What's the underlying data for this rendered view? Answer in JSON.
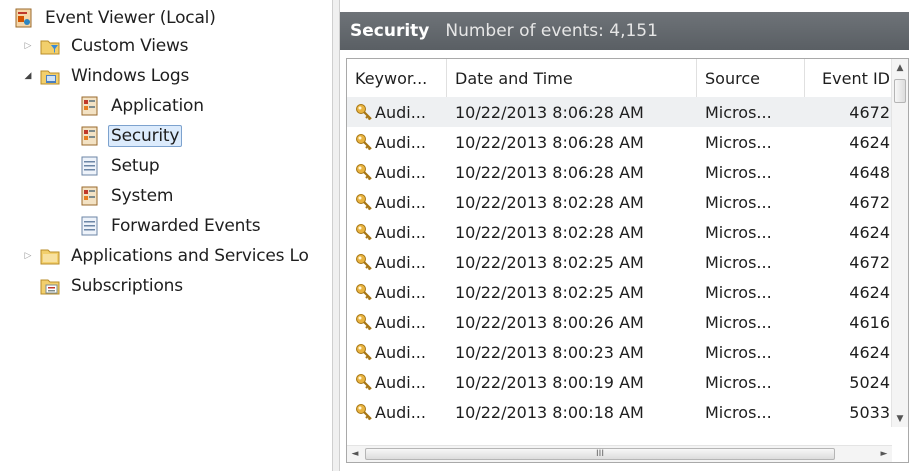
{
  "tree": {
    "root": {
      "label": "Event Viewer (Local)",
      "icon": "event-viewer-icon"
    },
    "items": [
      {
        "label": "Custom Views",
        "icon": "folder-filter-icon",
        "expander": "collapsed"
      },
      {
        "label": "Windows Logs",
        "icon": "windows-logs-icon",
        "expander": "expanded"
      },
      {
        "label": "Application",
        "icon": "log-icon"
      },
      {
        "label": "Security",
        "icon": "log-icon",
        "selected": true
      },
      {
        "label": "Setup",
        "icon": "log-plain-icon"
      },
      {
        "label": "System",
        "icon": "log-icon"
      },
      {
        "label": "Forwarded Events",
        "icon": "log-plain-icon"
      },
      {
        "label": "Applications and Services Lo",
        "icon": "folder-icon",
        "expander": "collapsed"
      },
      {
        "label": "Subscriptions",
        "icon": "subscriptions-icon"
      }
    ]
  },
  "panel": {
    "title": "Security",
    "count_text": "Number of events: 4,151"
  },
  "grid": {
    "columns": [
      "Keywor...",
      "Date and Time",
      "Source",
      "Event ID"
    ],
    "rows": [
      {
        "keyword": "Audi...",
        "datetime": "10/22/2013 8:06:28 AM",
        "source": "Micros...",
        "event_id": "4672"
      },
      {
        "keyword": "Audi...",
        "datetime": "10/22/2013 8:06:28 AM",
        "source": "Micros...",
        "event_id": "4624"
      },
      {
        "keyword": "Audi...",
        "datetime": "10/22/2013 8:06:28 AM",
        "source": "Micros...",
        "event_id": "4648"
      },
      {
        "keyword": "Audi...",
        "datetime": "10/22/2013 8:02:28 AM",
        "source": "Micros...",
        "event_id": "4672"
      },
      {
        "keyword": "Audi...",
        "datetime": "10/22/2013 8:02:28 AM",
        "source": "Micros...",
        "event_id": "4624"
      },
      {
        "keyword": "Audi...",
        "datetime": "10/22/2013 8:02:25 AM",
        "source": "Micros...",
        "event_id": "4672"
      },
      {
        "keyword": "Audi...",
        "datetime": "10/22/2013 8:02:25 AM",
        "source": "Micros...",
        "event_id": "4624"
      },
      {
        "keyword": "Audi...",
        "datetime": "10/22/2013 8:00:26 AM",
        "source": "Micros...",
        "event_id": "4616"
      },
      {
        "keyword": "Audi...",
        "datetime": "10/22/2013 8:00:23 AM",
        "source": "Micros...",
        "event_id": "4624"
      },
      {
        "keyword": "Audi...",
        "datetime": "10/22/2013 8:00:19 AM",
        "source": "Micros...",
        "event_id": "5024"
      },
      {
        "keyword": "Audi...",
        "datetime": "10/22/2013 8:00:18 AM",
        "source": "Micros...",
        "event_id": "5033"
      }
    ],
    "keyword_icon": "key-icon"
  },
  "scrollbars": {
    "up": "▲",
    "down": "▼",
    "left": "◄",
    "right": "►",
    "grip": "III"
  },
  "colors": {
    "header_bg": "#5f6469",
    "selection_bg": "#dcebfc",
    "selection_border": "#7da2ce"
  }
}
